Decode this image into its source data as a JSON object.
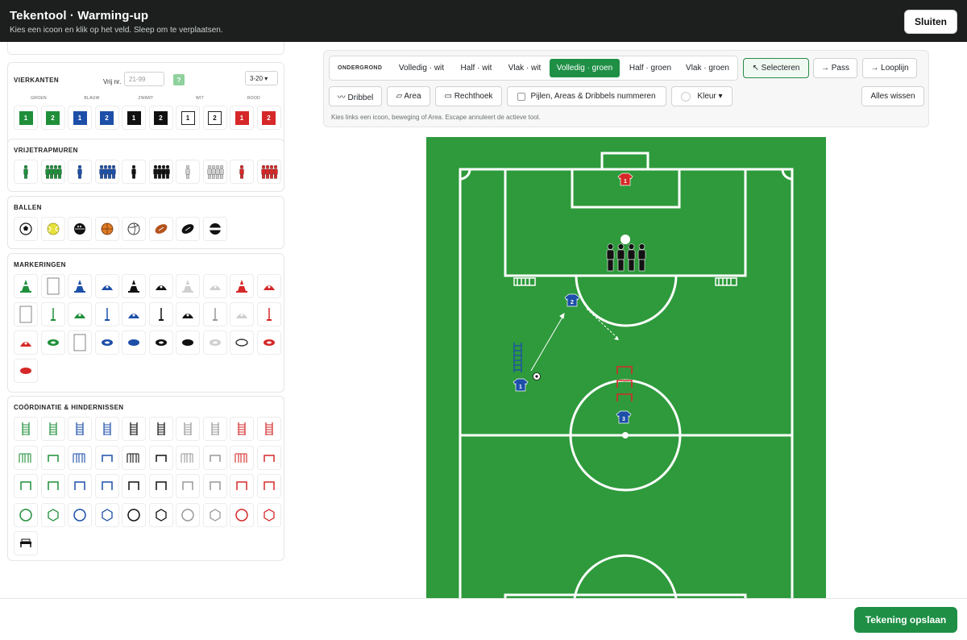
{
  "header": {
    "title": "Tekentool · Warming-up",
    "subtitle": "Kies een icoon en klik op het veld. Sleep om te verplaatsen.",
    "close_label": "Sluiten"
  },
  "sections": {
    "squares": {
      "title": "VIERKANTEN",
      "free_nr_label": "Vrij nr.",
      "free_nr_placeholder": "21-99",
      "help_label": "?",
      "range_value": "3-20 ▾",
      "color_labels": [
        "GROEN",
        "BLAUW",
        "ZWART",
        "WIT",
        "ROOD"
      ],
      "numbers": [
        "1",
        "2",
        "1",
        "2",
        "1",
        "2",
        "1",
        "2",
        "1",
        "2"
      ]
    },
    "walls": {
      "title": "VRIJETRAPMUREN"
    },
    "balls": {
      "title": "BALLEN"
    },
    "markers": {
      "title": "MARKERINGEN"
    },
    "coordination": {
      "title": "COÖRDINATIE & HINDERNISSEN"
    }
  },
  "toolbar": {
    "background_label": "ONDERGROND",
    "background_options": [
      "Volledig · wit",
      "Half · wit",
      "Vlak · wit",
      "Volledig · groen",
      "Half · groen",
      "Vlak · groen"
    ],
    "background_selected": "Volledig · groen",
    "select_label": "↖ Selecteren",
    "pass_label": "→ Pass",
    "runline_label": "→ Looplijn",
    "dribble_label": "〰 Dribbel",
    "area_label": "▱ Area",
    "rect_label": "▭ Rechthoek",
    "numbering_label": "Pijlen, Areas & Dribbels nummeren",
    "color_label": "Kleur ▾",
    "clear_label": "Alles wissen",
    "hint": "Kies links een icoon, beweging of Area. Escape annuleert de actieve tool."
  },
  "pitch": {
    "players": [
      {
        "number": "1",
        "team": "red"
      },
      {
        "number": "2",
        "team": "blue"
      },
      {
        "number": "1",
        "team": "blue"
      },
      {
        "number": "3",
        "team": "blue"
      }
    ]
  },
  "footer": {
    "save_label": "Tekening opslaan"
  },
  "colors": {
    "accent": "#1e8f45",
    "pitch": "#2e9a3b",
    "green": "#1f8f3a",
    "blue": "#1d4fa8",
    "black": "#111111",
    "red": "#d62828"
  }
}
